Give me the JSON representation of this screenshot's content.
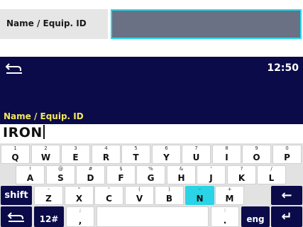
{
  "field": {
    "label": "Name / Equip. ID",
    "value": ""
  },
  "screen": {
    "time": "12:50",
    "prompt": "Name / Equip. ID",
    "input_value": "IRON"
  },
  "colors": {
    "screen_bg": "#0b0b4a",
    "accent_cyan": "#2ad4e6",
    "prompt_yellow": "#f4e85a"
  },
  "keyboard": {
    "row1": [
      {
        "sub": "1",
        "main": "Q"
      },
      {
        "sub": "2",
        "main": "W"
      },
      {
        "sub": "3",
        "main": "E"
      },
      {
        "sub": "4",
        "main": "R"
      },
      {
        "sub": "5",
        "main": "T"
      },
      {
        "sub": "6",
        "main": "Y"
      },
      {
        "sub": "7",
        "main": "U"
      },
      {
        "sub": "8",
        "main": "I"
      },
      {
        "sub": "9",
        "main": "O"
      },
      {
        "sub": "0",
        "main": "P"
      }
    ],
    "row2": [
      {
        "sub": "!",
        "main": "A"
      },
      {
        "sub": "@",
        "main": "S"
      },
      {
        "sub": "#",
        "main": "D"
      },
      {
        "sub": "$",
        "main": "F"
      },
      {
        "sub": "%",
        "main": "G"
      },
      {
        "sub": "&",
        "main": "H"
      },
      {
        "sub": "'",
        "main": "J"
      },
      {
        "sub": "?",
        "main": "K"
      },
      {
        "sub": "/",
        "main": "L"
      }
    ],
    "row3": [
      {
        "sub": "-",
        "main": "Z"
      },
      {
        "sub": "\"",
        "main": "X"
      },
      {
        "sub": "'",
        "main": "C"
      },
      {
        "sub": "(",
        "main": "V"
      },
      {
        "sub": ")",
        "main": "B"
      },
      {
        "sub": "-",
        "main": "N"
      },
      {
        "sub": "+",
        "main": "M"
      }
    ],
    "row3_highlight": "N",
    "shift_label": "shift",
    "backspace_icon": "←",
    "symbols_label": "12#",
    "comma_sub": ";",
    "comma_main": ",",
    "period_sub": ":",
    "period_main": ".",
    "lang_label": "eng",
    "enter_icon": "↵",
    "back_icon": "return-arrow-icon"
  }
}
